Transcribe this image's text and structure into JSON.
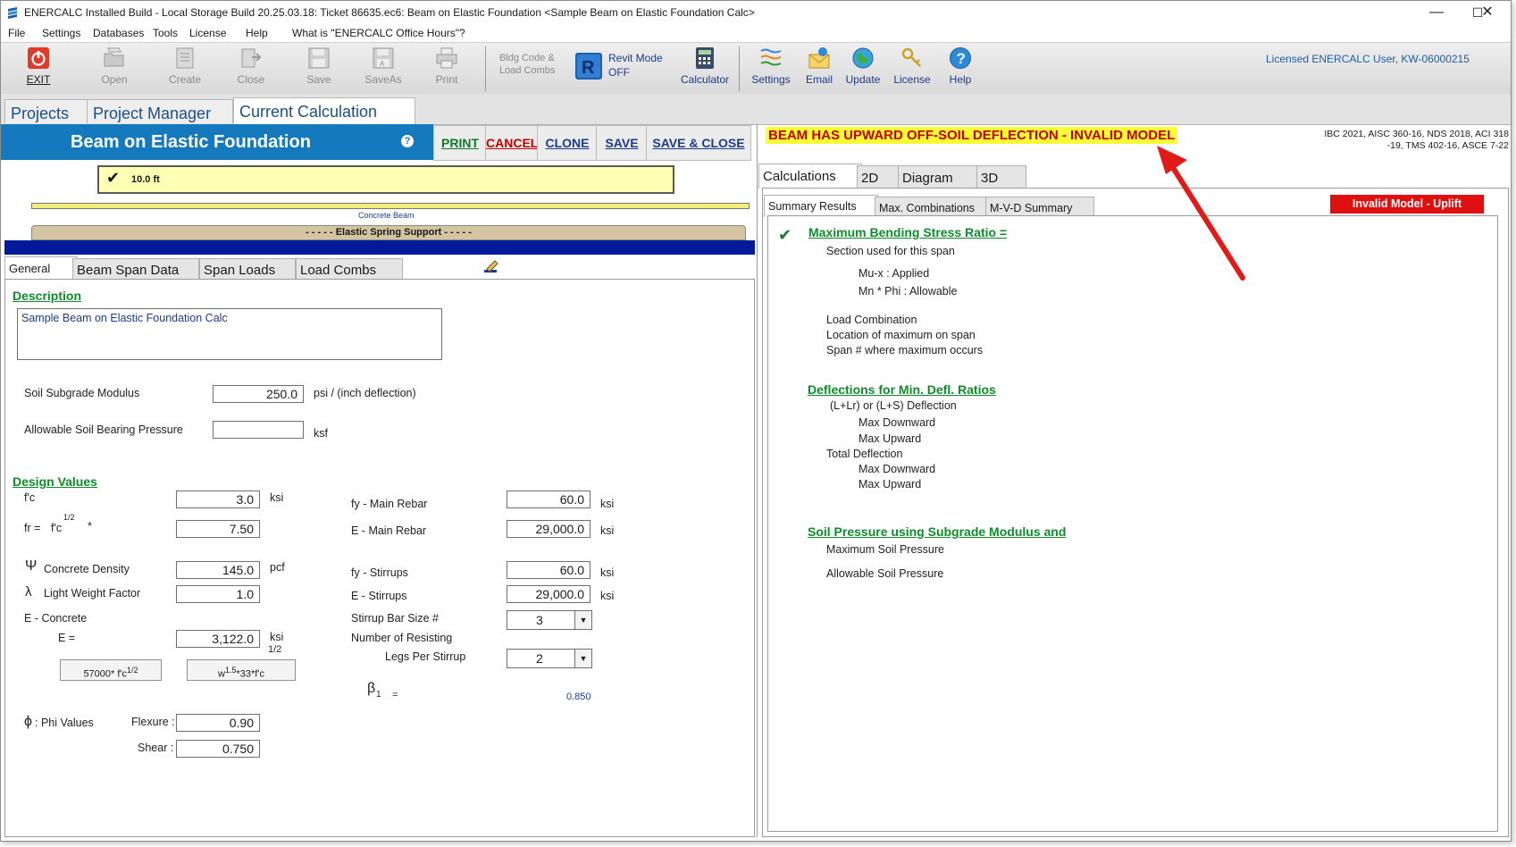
{
  "window": {
    "title": "ENERCALC Installed Build - Local Storage Build 20.25.03.18: Ticket 86635.ec6: Beam on Elastic Foundation <Sample Beam on Elastic Foundation Calc>",
    "controls": {
      "minimize": "—",
      "maximize": "☐",
      "close": "✕"
    }
  },
  "menu": [
    "File",
    "Settings",
    "Databases",
    "Tools",
    "License",
    "Help",
    "What is \"ENERCALC Office Hours\"?"
  ],
  "toolbar": {
    "exit": "EXIT",
    "open": "Open",
    "create": "Create",
    "close": "Close",
    "save": "Save",
    "saveas": "SaveAs",
    "print": "Print",
    "bldg_code_line1": "Bldg Code &",
    "bldg_code_line2": "Load Combs",
    "revit_line1": "Revit Mode",
    "revit_line2": "OFF",
    "calculator": "Calculator",
    "settings": "Settings",
    "email": "Email",
    "update": "Update",
    "license": "License",
    "help": "Help",
    "licensed_user": "Licensed ENERCALC User, KW-06000215"
  },
  "top_tabs": [
    "Projects",
    "Project Manager",
    "Current Calculation"
  ],
  "header": {
    "title": "Beam on Elastic Foundation",
    "help": "?",
    "print": "PRINT",
    "cancel": "CANCEL",
    "clone": "CLONE",
    "save": "SAVE",
    "save_close": "SAVE & CLOSE",
    "cancel_color": "#c00000",
    "print_color": "#0d7a2a",
    "blue_color": "#1a3c8c"
  },
  "beam": {
    "span_check": "✔",
    "span_label": "10.0 ft",
    "caption": "Concrete Beam",
    "support": "- - - - - Elastic Spring Support - - - - -"
  },
  "left_tabs": [
    "General",
    "Beam Span Data",
    "Span Loads",
    "Load Combs"
  ],
  "general": {
    "description_title": "Description",
    "description": "Sample Beam on Elastic Foundation Calc",
    "soil_modulus_label": "Soil Subgrade Modulus",
    "soil_modulus_value": "250.0",
    "soil_modulus_unit": "psi / (inch deflection)",
    "allow_bearing_label": "Allowable Soil Bearing Pressure",
    "allow_bearing_value": "",
    "allow_bearing_unit": "ksf",
    "design_values_title": "Design Values",
    "fc_label": "f'c",
    "fc_value": "3.0",
    "fc_unit": "ksi",
    "fr_label": "fr =",
    "fr_formula": "f'c",
    "fr_exp": "1/2",
    "fr_star": "*",
    "fr_value": "7.50",
    "psi_symbol": "Ψ",
    "density_label": "Concrete Density",
    "density_value": "145.0",
    "density_unit": "pcf",
    "lambda_symbol": "λ",
    "lwf_label": "Light Weight Factor",
    "lwf_value": "1.0",
    "ec_label": "E - Concrete",
    "e_eq_label": "E =",
    "e_value": "3,122.0",
    "e_unit": "ksi",
    "e_exp": "1/2",
    "btn_57000": "57000* f'c",
    "btn_57000_exp": "1/2",
    "btn_w_base": "w",
    "btn_w_exp": "1.5",
    "btn_w_rest": "*33*f'c",
    "fy_main_label": "fy - Main Rebar",
    "fy_main_value": "60.0",
    "fy_main_unit": "ksi",
    "e_main_label": "E - Main Rebar",
    "e_main_value": "29,000.0",
    "e_main_unit": "ksi",
    "fy_stir_label": "fy - Stirrups",
    "fy_stir_value": "60.0",
    "fy_stir_unit": "ksi",
    "e_stir_label": "E - Stirrups",
    "e_stir_value": "29,000.0",
    "e_stir_unit": "ksi",
    "stirrup_size_label": "Stirrup Bar Size #",
    "stirrup_size_value": "3",
    "legs_label1": "Number of Resisting",
    "legs_label2": "Legs Per Stirrup",
    "legs_value": "2",
    "beta_symbol": "β",
    "beta_sub": "1",
    "beta_eq": "=",
    "beta_value": "0.850",
    "phi_symbol": "ϕ",
    "phi_label": ": Phi Values",
    "flexure_label": "Flexure :",
    "flexure_value": "0.90",
    "shear_label": "Shear :",
    "shear_value": "0.750"
  },
  "right": {
    "warning": "BEAM HAS UPWARD OFF-SOIL DEFLECTION - INVALID MODEL",
    "codes_line1": "IBC 2021, AISC 360-16, NDS 2018, ACI 318",
    "codes_line2": "-19, TMS 402-16, ASCE 7-22",
    "tabs": [
      "Calculations",
      "2D",
      "Diagram",
      "3D"
    ],
    "subtabs": [
      "Summary Results",
      "Max. Combinations",
      "M-V-D Summary"
    ],
    "invalid_badge": "Invalid Model - Uplift",
    "check": "✔",
    "bending_title": "Maximum Bending Stress Ratio    =",
    "section_used": "Section used for this span",
    "mux": "Mu-x : Applied",
    "mn": "Mn * Phi : Allowable",
    "load_comb": "Load Combination",
    "location_max": "Location of maximum on span",
    "span_num": "Span # where maximum occurs",
    "defl_title": "Deflections for Min. Defl. Ratios",
    "llr": "(L+Lr) or (L+S) Deflection",
    "max_down1": "Max Downward",
    "max_up1": "Max Upward",
    "total_defl": "Total Deflection",
    "max_down2": "Max Downward",
    "max_up2": "Max Upward",
    "soil_title": "Soil Pressure using Subgrade Modulus and",
    "max_soil": "Maximum Soil Pressure",
    "allow_soil": "Allowable Soil Pressure"
  }
}
